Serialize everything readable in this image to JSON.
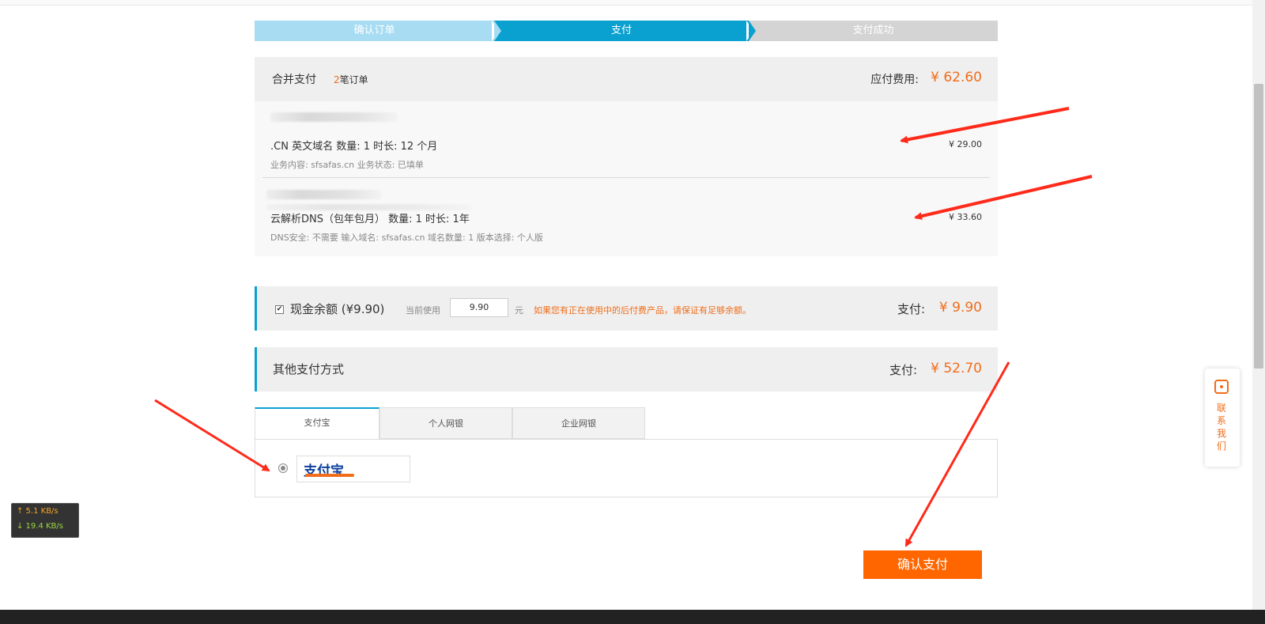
{
  "steps": {
    "step1": "确认订单",
    "step2": "支付",
    "step3": "支付成功"
  },
  "merge": {
    "title": "合并支付",
    "count": "2",
    "count_suffix": "笔订单",
    "due_label": "应付费用:",
    "due_amount": "¥ 62.60"
  },
  "orders": [
    {
      "line": ".CN 英文域名    数量:  1          时长:  12 个月",
      "sub": "业务内容:  sfsafas.cn    业务状态:  已填单",
      "price": "¥ 29.00"
    },
    {
      "line": "云解析DNS（包年包月） 数量: 1 时长: 1年",
      "sub": "DNS安全: 不需要 输入域名: sfsafas.cn 域名数量: 1 版本选择: 个人版",
      "price": "¥ 33.60"
    }
  ],
  "balance": {
    "checked": "✔",
    "label": "现金余额  (¥9.90)",
    "using_label": "当前使用",
    "input_value": "9.90",
    "unit": "元",
    "warning": "如果您有正在使用中的后付费产品，请保证有足够余额。",
    "pay_label": "支付:",
    "pay_amount": "¥ 9.90"
  },
  "other": {
    "title": "其他支付方式",
    "pay_label": "支付:",
    "pay_amount": "¥ 52.70"
  },
  "tabs": [
    "支付宝",
    "个人网银",
    "企业网银"
  ],
  "alipay": {
    "logo_text": "支付宝",
    "icon": "alipay-logo"
  },
  "confirm_label": "确认支付",
  "speed": {
    "up": "↑ 5.1 KB/s",
    "down": "↓ 19.4 KB/s"
  },
  "contact": {
    "text": "联系我们",
    "icon": "contact-icon"
  },
  "colors": {
    "accent": "#0aa1d1",
    "orange": "#f06d1a",
    "confirm": "#ff6600",
    "annotation_red": "#ff2a1a"
  }
}
